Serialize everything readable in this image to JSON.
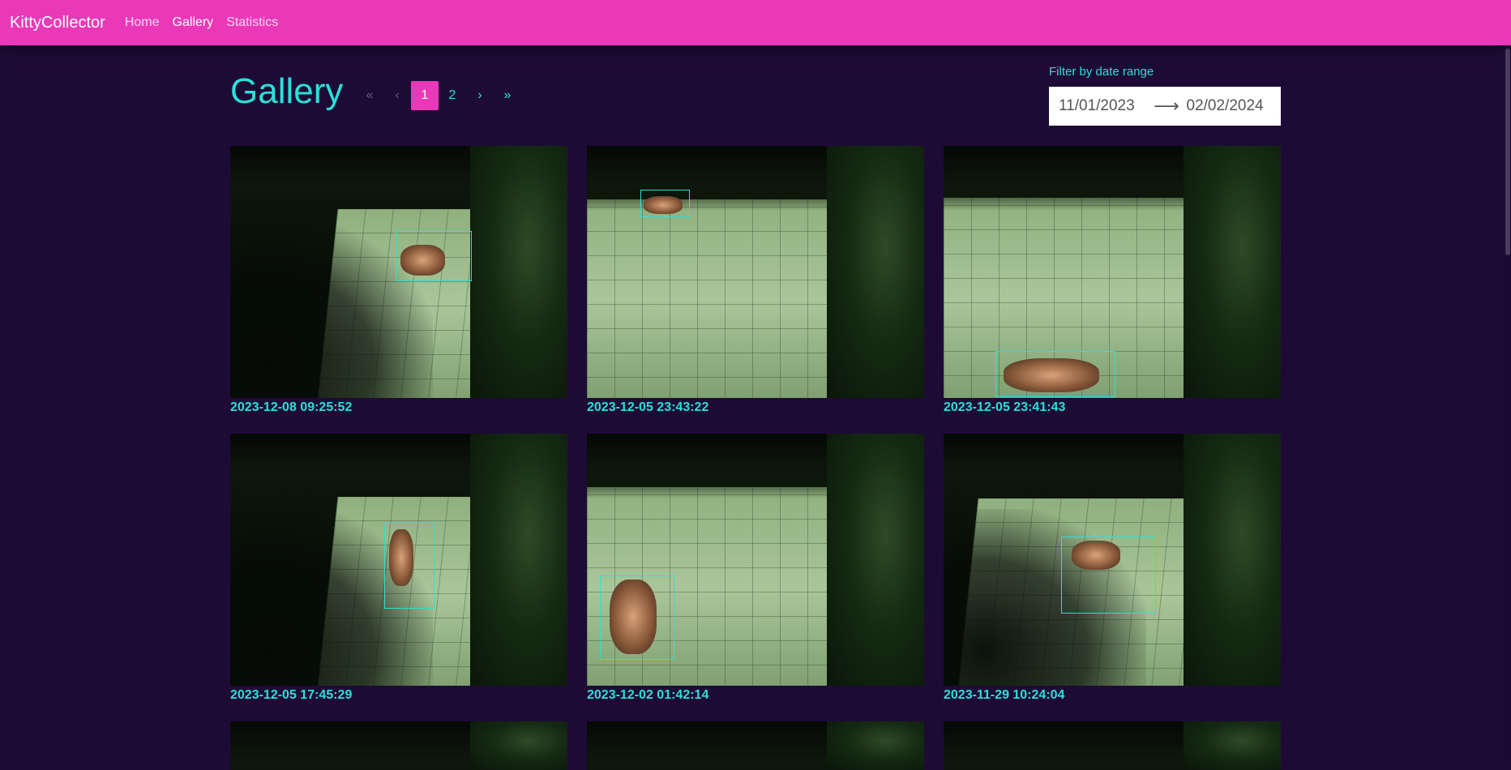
{
  "navbar": {
    "brand": "KittyCollector",
    "links": [
      "Home",
      "Gallery",
      "Statistics"
    ]
  },
  "page": {
    "title": "Gallery"
  },
  "pagination": {
    "first": "«",
    "prev": "‹",
    "pages": [
      "1",
      "2"
    ],
    "current": "1",
    "next": "›",
    "last": "»"
  },
  "filter": {
    "label": "Filter by date range",
    "start": "11/01/2023",
    "arrow": "⟶",
    "end": "02/02/2024"
  },
  "gallery": {
    "items": [
      {
        "timestamp": "2023-12-08 09:25:52"
      },
      {
        "timestamp": "2023-12-05 23:43:22"
      },
      {
        "timestamp": "2023-12-05 23:41:43"
      },
      {
        "timestamp": "2023-12-05 17:45:29"
      },
      {
        "timestamp": "2023-12-02 01:42:14"
      },
      {
        "timestamp": "2023-11-29 10:24:04"
      }
    ]
  },
  "colors": {
    "accent": "#ea39b8",
    "text_accent": "#2be0d8",
    "background": "#1e0b35"
  }
}
